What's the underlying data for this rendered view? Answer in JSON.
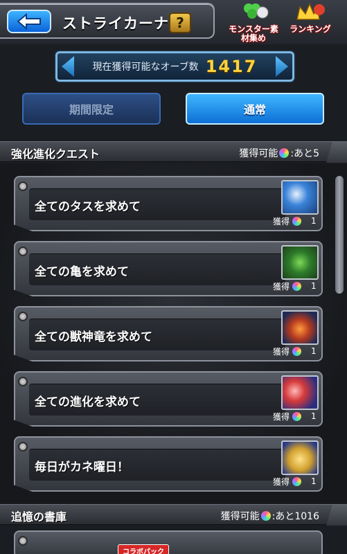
{
  "header": {
    "title": "ストライカーナビ",
    "help_label": "?",
    "materials_label": "モンスター素材集め",
    "ranking_label": "ランキング"
  },
  "orb_counter": {
    "label": "現在獲得可能なオーブ数",
    "value": "1417"
  },
  "tabs": [
    {
      "label": "期間限定",
      "active": false
    },
    {
      "label": "通常",
      "active": true
    }
  ],
  "sections": {
    "evolution": {
      "title": "強化進化クエスト",
      "stat_prefix": "獲得可能",
      "stat_suffix": ":あと5"
    },
    "memory": {
      "title": "追憶の書庫",
      "stat_prefix": "獲得可能",
      "stat_suffix": ":あと1016"
    }
  },
  "quests": [
    {
      "name": "全てのタスを求めて",
      "reward_label": "獲得",
      "reward_count": "1"
    },
    {
      "name": "全ての亀を求めて",
      "reward_label": "獲得",
      "reward_count": "1"
    },
    {
      "name": "全ての獣神竜を求めて",
      "reward_label": "獲得",
      "reward_count": "1"
    },
    {
      "name": "全ての進化を求めて",
      "reward_label": "獲得",
      "reward_count": "1"
    },
    {
      "name": "毎日がカネ曜日！",
      "reward_label": "獲得",
      "reward_count": "1"
    }
  ],
  "collab_badge": "コラボパック",
  "icons": {
    "back": "back-arrow-icon",
    "orb": "rainbow-orb-icon"
  }
}
